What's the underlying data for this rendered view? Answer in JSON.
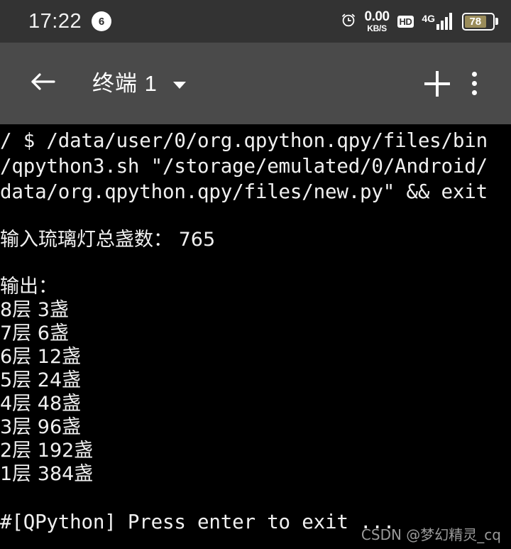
{
  "statusbar": {
    "time": "17:22",
    "notification_count": "6",
    "alarm_icon": "alarm-clock-icon",
    "network_speed": "0.00",
    "network_speed_unit": "KB/S",
    "hd_label": "HD",
    "network_type": "4G",
    "signal_bars": 4,
    "battery_percent": "78",
    "battery_color": "#9a8c5a",
    "background": "#333333"
  },
  "toolbar": {
    "back_icon": "back-arrow-icon",
    "title": "终端 1",
    "dropdown_icon": "chevron-down-icon",
    "add_icon": "plus-icon",
    "overflow_icon": "more-vertical-icon",
    "background": "#4a4a4a"
  },
  "terminal": {
    "background": "#000000",
    "foreground": "#f0f0f0",
    "command_lines": [
      "/ $ /data/user/0/org.qpython.qpy/files/bin",
      "/qpython3.sh \"/storage/emulated/0/Android/",
      "data/org.qpython.qpy/files/new.py\" && exit"
    ],
    "input_line": "输入琉璃灯总盏数： 765",
    "output_label": "输出：",
    "output_rows": [
      "8层 3盏",
      "7层 6盏",
      "6层 12盏",
      "5层 24盏",
      "4层 48盏",
      "3层 96盏",
      "2层 192盏",
      "1层 384盏"
    ],
    "exit_prompt": "#[QPython] Press enter to exit ..."
  },
  "watermark": {
    "text": "CSDN @梦幻精灵_cq",
    "color": "#9a9a9a"
  }
}
